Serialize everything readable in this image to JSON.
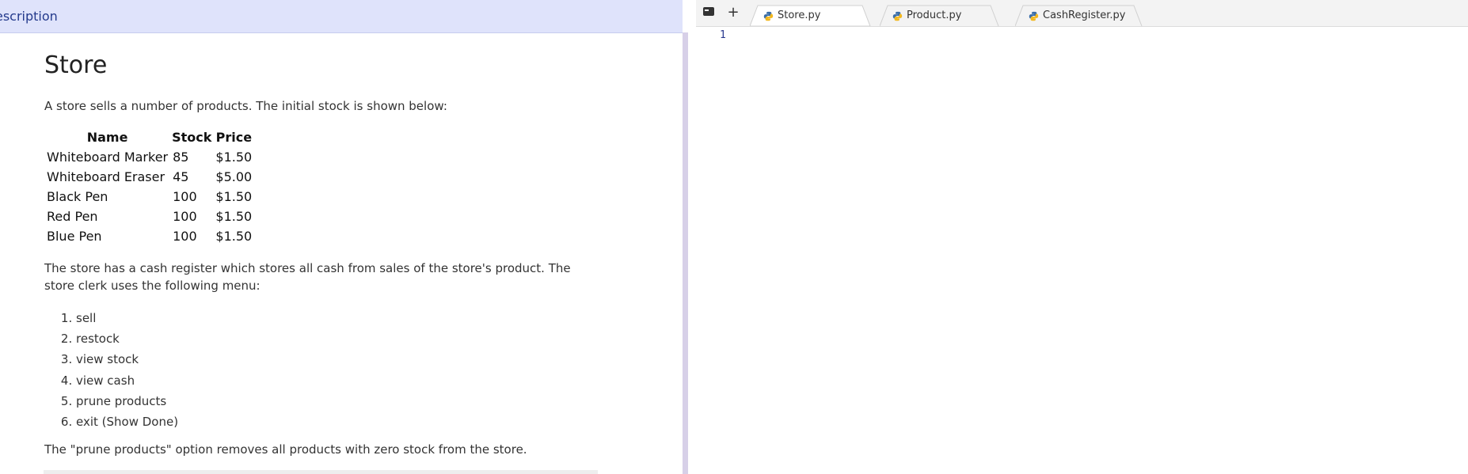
{
  "description_panel": {
    "header_label": "escription",
    "title": "Store",
    "intro": "A store sells a number of products. The initial stock is shown below:",
    "table": {
      "headers": [
        "Name",
        "Stock",
        "Price"
      ],
      "rows": [
        [
          "Whiteboard Marker",
          "85",
          "$1.50"
        ],
        [
          "Whiteboard Eraser",
          "45",
          "$5.00"
        ],
        [
          "Black Pen",
          "100",
          "$1.50"
        ],
        [
          "Red Pen",
          "100",
          "$1.50"
        ],
        [
          "Blue Pen",
          "100",
          "$1.50"
        ]
      ]
    },
    "register_text": "The store has a cash register which stores all cash from sales of the store's product. The store clerk uses the following menu:",
    "menu": [
      "sell",
      "restock",
      "view stock",
      "view cash",
      "prune products",
      "exit (Show Done)"
    ],
    "prune_text": "The \"prune products\" option removes all products with zero stock from the store."
  },
  "editor": {
    "tabs": [
      {
        "label": "Store.py",
        "active": true,
        "icon": "python-icon"
      },
      {
        "label": "Product.py",
        "active": false,
        "icon": "python-icon"
      },
      {
        "label": "CashRegister.py",
        "active": false,
        "icon": "python-icon"
      }
    ],
    "toolbar": {
      "terminal_icon": "terminal-icon",
      "add_label": "+"
    },
    "line_numbers": [
      "1"
    ]
  },
  "colors": {
    "header_bg": "#dfe3fb",
    "header_text": "#243a8c",
    "splitter": "#d7d0e8",
    "line_number": "#2a3a8f",
    "python_blue": "#3b6ea8",
    "python_yellow": "#f2b81f"
  }
}
